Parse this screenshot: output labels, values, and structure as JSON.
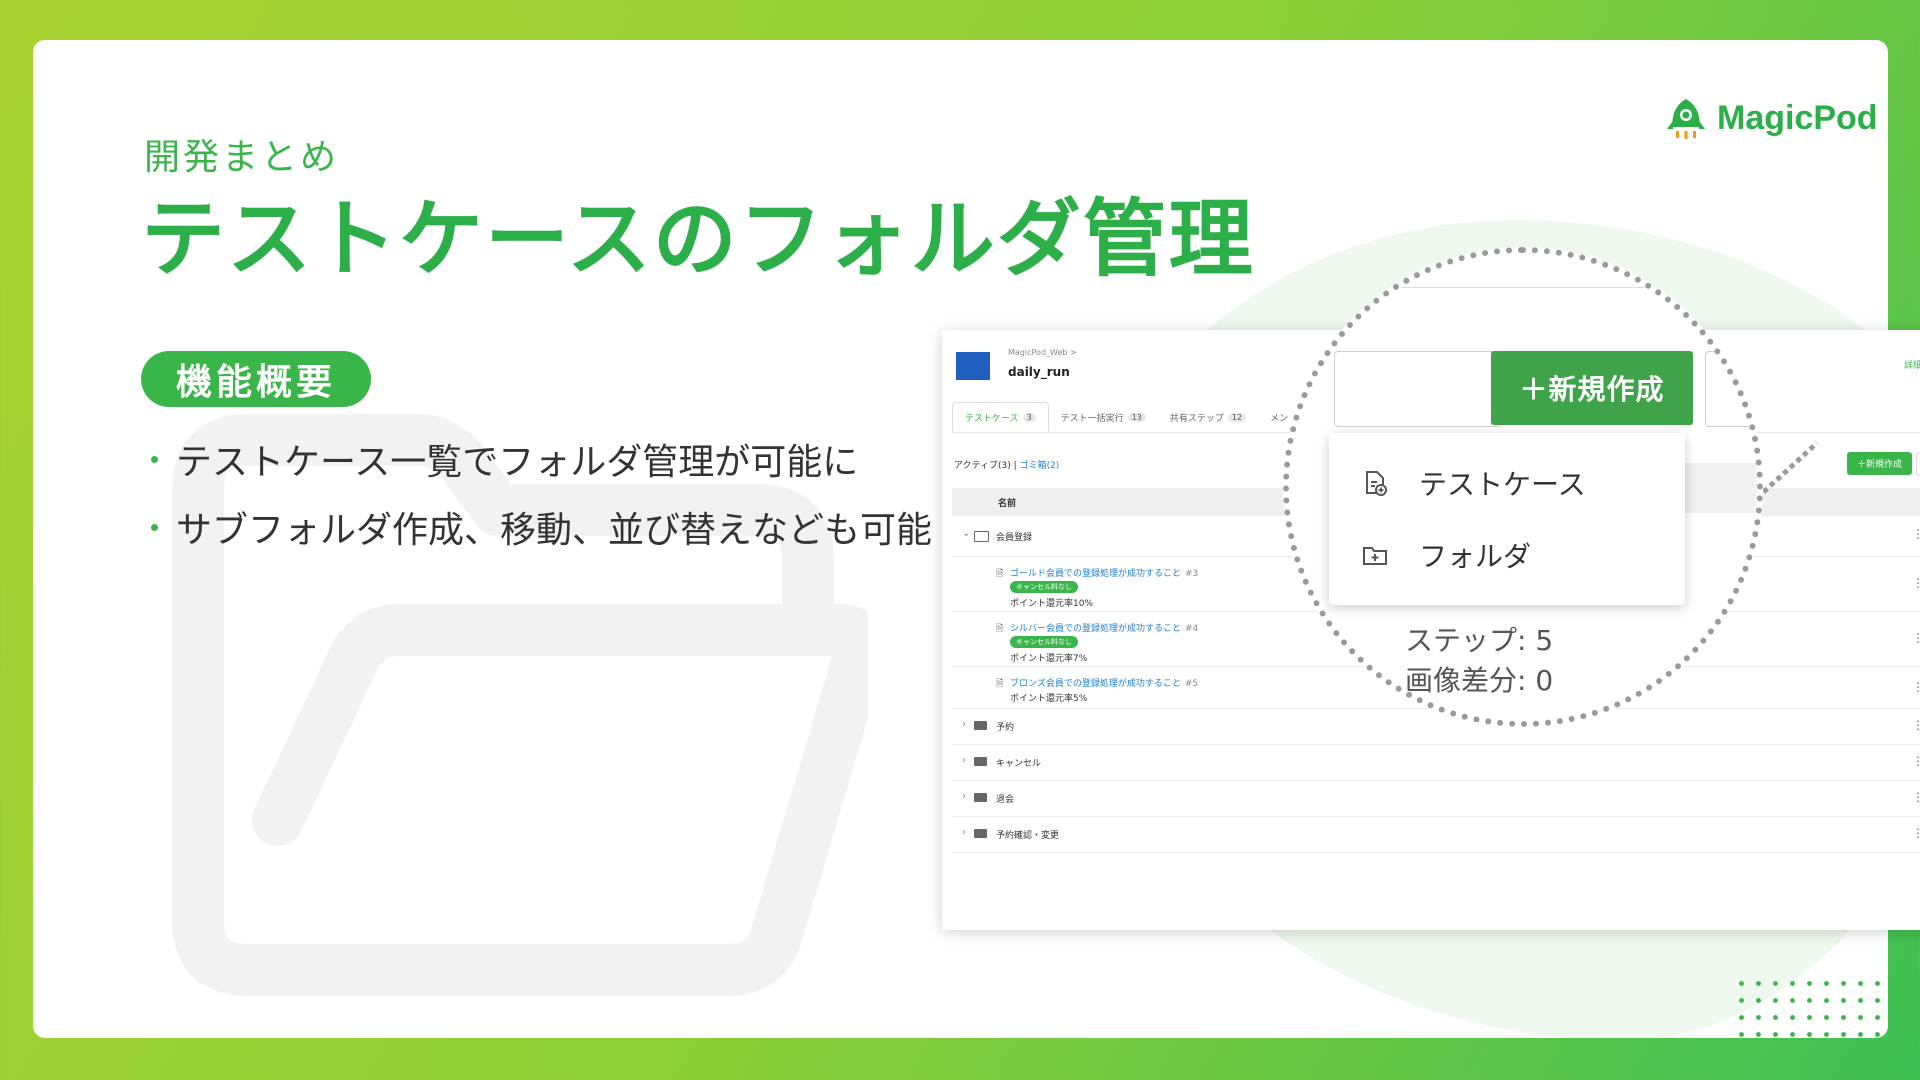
{
  "slide": {
    "subtitle": "開発まとめ",
    "title": "テストケースのフォルダ管理",
    "badge": "機能概要",
    "bullets": [
      "テストケース一覧でフォルダ管理が可能に",
      "サブフォルダ作成、移動、並び替えなども可能"
    ],
    "logo_text": "MagicPod",
    "accent_color": "#39b54a"
  },
  "app": {
    "breadcrumb": "MagicPod_Web",
    "project_name": "daily_run",
    "detail_link": "詳細",
    "tabs": [
      {
        "label": "テストケース",
        "count": "3"
      },
      {
        "label": "テスト一括実行",
        "count": "13"
      },
      {
        "label": "共有ステップ",
        "count": "12"
      },
      {
        "label": "メン"
      }
    ],
    "filter_active": "アクティブ(3)",
    "filter_separator": "|",
    "filter_trash": "ゴミ箱(2)",
    "new_button_small": "＋新規作成",
    "column_name": "名前",
    "folder_open": "会員登録",
    "test_cases": [
      {
        "title": "ゴールド会員での登録処理が成功すること",
        "num": "#3",
        "tag": "キャンセル料なし",
        "desc": "ポイント還元率10%"
      },
      {
        "title": "シルバー会員での登録処理が成功すること",
        "num": "#4",
        "tag": "キャンセル料なし",
        "desc": "ポイント還元率7%"
      },
      {
        "title": "ブロンズ会員での登録処理が成功すること",
        "num": "#5",
        "desc": "ポイント還元率5%"
      }
    ],
    "folders": [
      "予約",
      "キャンセル",
      "退会",
      "予約確認・変更"
    ]
  },
  "magnifier": {
    "new_button": "＋新規作成",
    "menu_items": [
      {
        "label": "テストケース",
        "icon": "file-add-icon"
      },
      {
        "label": "フォルダ",
        "icon": "folder-add-icon"
      }
    ],
    "steps": "ステップ: 5",
    "image_diff": "画像差分: 0"
  }
}
